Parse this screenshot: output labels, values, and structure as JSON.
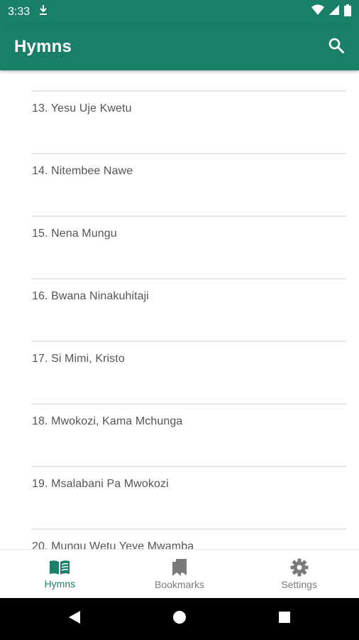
{
  "status_bar": {
    "time": "3:33",
    "icons": [
      "download-notification-icon",
      "wifi-icon",
      "signal-icon",
      "battery-icon"
    ]
  },
  "app_bar": {
    "title": "Hymns",
    "search_icon": "search-icon",
    "color": "#1a7f69"
  },
  "hymns": [
    {
      "label": "13. Yesu Uje Kwetu"
    },
    {
      "label": "14. Nitembee Nawe"
    },
    {
      "label": "15. Nena Mungu"
    },
    {
      "label": "16. Bwana Ninakuhitaji"
    },
    {
      "label": "17. Si Mimi, Kristo"
    },
    {
      "label": "18. Mwokozi, Kama Mchunga"
    },
    {
      "label": "19. Msalabani Pa Mwokozi"
    },
    {
      "label": "20. Mungu Wetu Yeye Mwamba"
    }
  ],
  "bottom_nav": {
    "items": [
      {
        "label": "Hymns",
        "icon": "book-icon",
        "active": true
      },
      {
        "label": "Bookmarks",
        "icon": "bookmarks-icon",
        "active": false
      },
      {
        "label": "Settings",
        "icon": "gear-icon",
        "active": false
      }
    ],
    "active_color": "#1a7f69",
    "inactive_color": "#7a7a7a"
  },
  "system_nav": {
    "icons": [
      "back-icon",
      "home-icon",
      "recents-icon"
    ]
  }
}
